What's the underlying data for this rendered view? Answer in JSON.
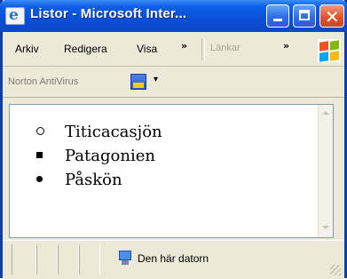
{
  "window": {
    "title": "Listor - Microsoft Inter...",
    "title_bar_color": "#0a4fd6",
    "close_color": "#e0552a"
  },
  "menu": {
    "items": [
      "Arkiv",
      "Redigera",
      "Visa"
    ],
    "overflow_chevron": "»",
    "links_label": "Länkar",
    "links_chevron": "»"
  },
  "norton": {
    "label": "Norton AntiVirus",
    "dropdown_glyph": "▾"
  },
  "content": {
    "list_items": [
      {
        "text": "Titicacasjön",
        "bullet": "circle"
      },
      {
        "text": "Patagonien",
        "bullet": "square"
      },
      {
        "text": "Påskön",
        "bullet": "disc"
      }
    ]
  },
  "status": {
    "zone_text": "Den här datorn"
  },
  "icons": {
    "window_icon": "internet-explorer-icon",
    "windows_logo": "windows-flag-icon",
    "computer_icon": "my-computer-icon"
  }
}
